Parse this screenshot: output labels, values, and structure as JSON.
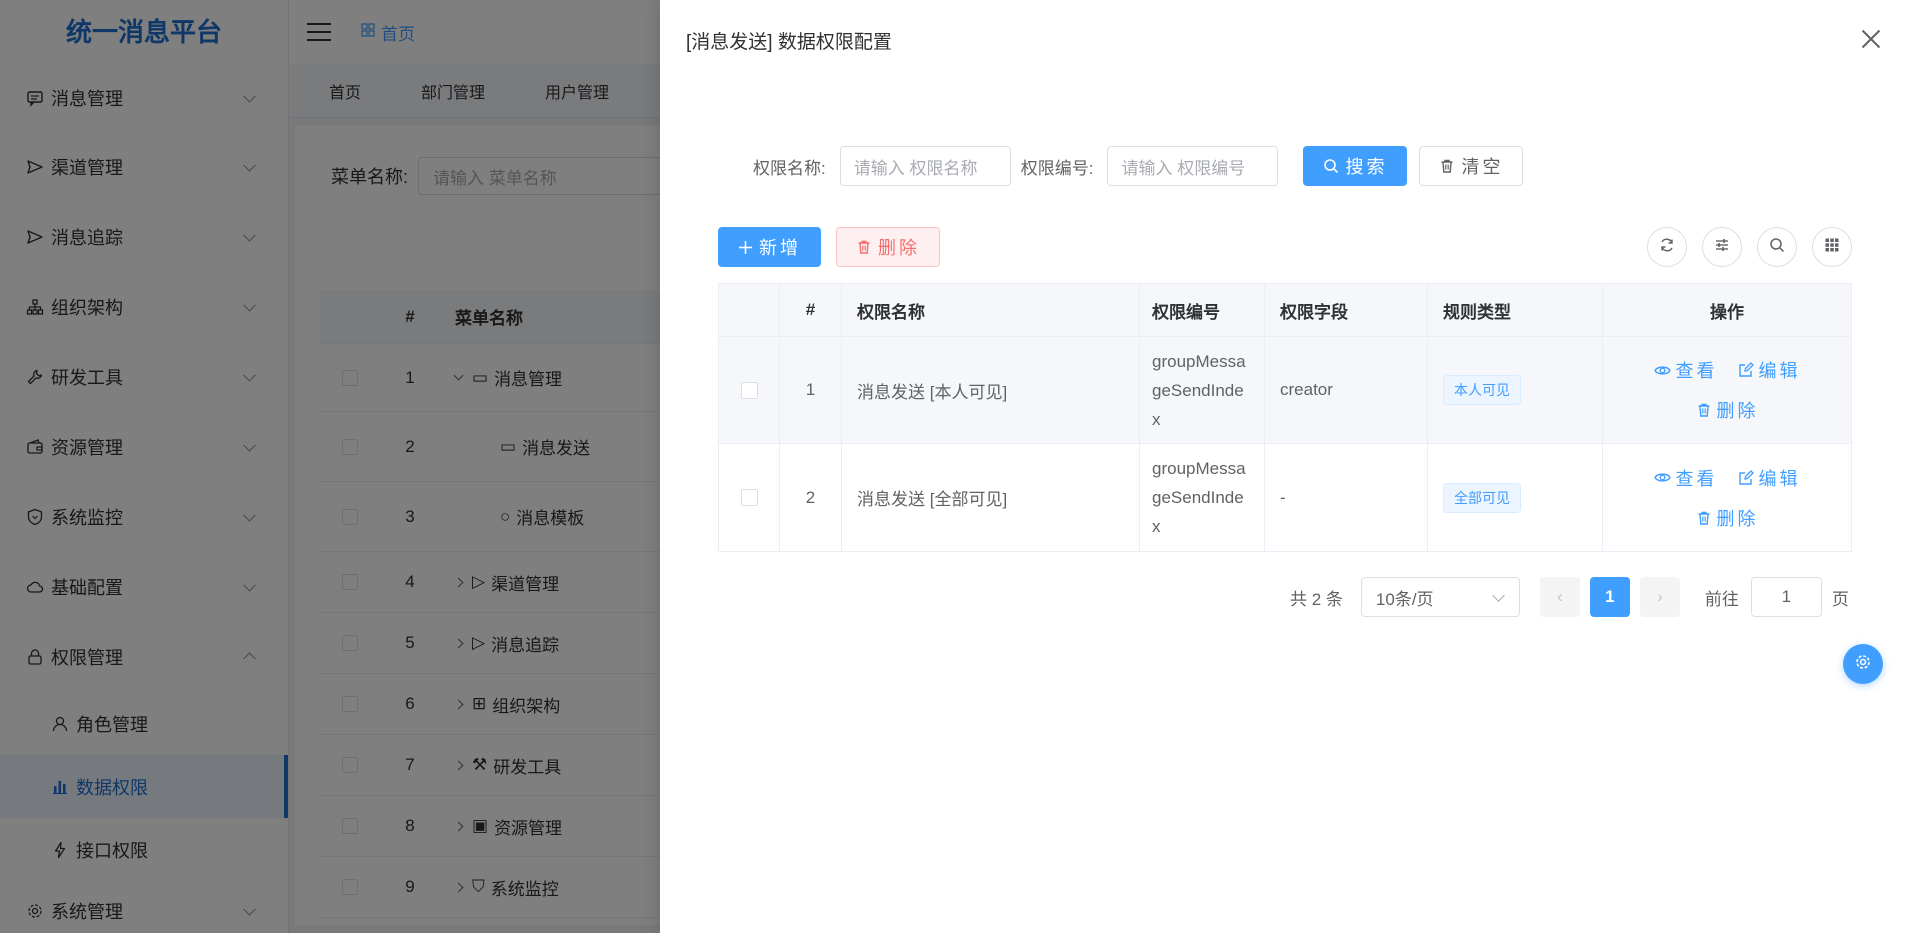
{
  "app": {
    "title": "统一消息平台"
  },
  "sidebar": {
    "items": [
      {
        "label": "消息管理",
        "icon": "message-icon"
      },
      {
        "label": "渠道管理",
        "icon": "send-icon"
      },
      {
        "label": "消息追踪",
        "icon": "send-icon"
      },
      {
        "label": "组织架构",
        "icon": "org-icon"
      },
      {
        "label": "研发工具",
        "icon": "wrench-icon"
      },
      {
        "label": "资源管理",
        "icon": "wallet-icon"
      },
      {
        "label": "系统监控",
        "icon": "shield-icon"
      },
      {
        "label": "基础配置",
        "icon": "cloud-icon"
      },
      {
        "label": "权限管理",
        "icon": "lock-icon",
        "expanded": true
      },
      {
        "label": "系统管理",
        "icon": "gear-icon"
      }
    ],
    "sub_items": [
      {
        "label": "角色管理",
        "icon": "user-icon"
      },
      {
        "label": "数据权限",
        "icon": "bar-chart-icon",
        "active": true
      },
      {
        "label": "接口权限",
        "icon": "lightning-icon"
      }
    ]
  },
  "topbar": {
    "breadcrumb": "首页"
  },
  "tabs": [
    "首页",
    "部门管理",
    "用户管理"
  ],
  "bg_content": {
    "search_label": "菜单名称:",
    "search_placeholder": "请输入 菜单名称",
    "table_header": {
      "index": "#",
      "name": "菜单名称"
    },
    "rows": [
      {
        "index": "1",
        "name": "消息管理"
      },
      {
        "index": "2",
        "name": "消息发送"
      },
      {
        "index": "3",
        "name": "消息模板"
      },
      {
        "index": "4",
        "name": "渠道管理"
      },
      {
        "index": "5",
        "name": "消息追踪"
      },
      {
        "index": "6",
        "name": "组织架构"
      },
      {
        "index": "7",
        "name": "研发工具"
      },
      {
        "index": "8",
        "name": "资源管理"
      },
      {
        "index": "9",
        "name": "系统监控"
      }
    ]
  },
  "drawer": {
    "title": "[消息发送] 数据权限配置",
    "form": {
      "name_label": "权限名称:",
      "name_placeholder": "请输入 权限名称",
      "code_label": "权限编号:",
      "code_placeholder": "请输入 权限编号",
      "search_label": "搜索",
      "clear_label": "清空"
    },
    "toolbar": {
      "add_label": "新增",
      "delete_label": "删除"
    },
    "table": {
      "headers": {
        "index": "#",
        "name": "权限名称",
        "code": "权限编号",
        "field": "权限字段",
        "rule": "规则类型",
        "ops": "操作"
      },
      "rows": [
        {
          "index": "1",
          "name": "消息发送 [本人可见]",
          "code": "groupMessageSendIndex",
          "field": "creator",
          "rule": "本人可见"
        },
        {
          "index": "2",
          "name": "消息发送 [全部可见]",
          "code": "groupMessageSendIndex",
          "field": "-",
          "rule": "全部可见"
        }
      ],
      "ops": {
        "view": "查看",
        "edit": "编辑",
        "delete": "删除"
      }
    },
    "pager": {
      "total": "共 2 条",
      "size": "10条/页",
      "current": "1",
      "goto_prefix": "前往",
      "goto_value": "1",
      "goto_suffix": "页"
    }
  },
  "colors": {
    "primary": "#409eff",
    "danger": "#f56c6c",
    "brand": "#1f6fd1"
  }
}
